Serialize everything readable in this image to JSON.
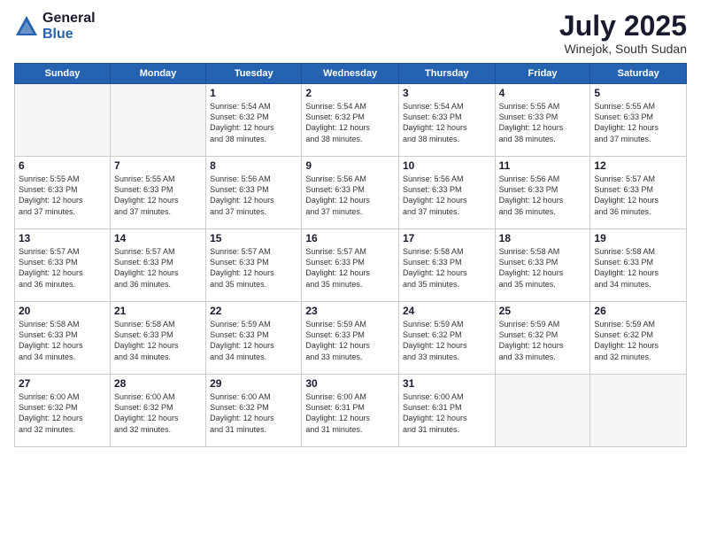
{
  "logo": {
    "general": "General",
    "blue": "Blue"
  },
  "header": {
    "month": "July 2025",
    "location": "Winejok, South Sudan"
  },
  "weekdays": [
    "Sunday",
    "Monday",
    "Tuesday",
    "Wednesday",
    "Thursday",
    "Friday",
    "Saturday"
  ],
  "weeks": [
    [
      {
        "day": "",
        "info": ""
      },
      {
        "day": "",
        "info": ""
      },
      {
        "day": "1",
        "info": "Sunrise: 5:54 AM\nSunset: 6:32 PM\nDaylight: 12 hours\nand 38 minutes."
      },
      {
        "day": "2",
        "info": "Sunrise: 5:54 AM\nSunset: 6:32 PM\nDaylight: 12 hours\nand 38 minutes."
      },
      {
        "day": "3",
        "info": "Sunrise: 5:54 AM\nSunset: 6:33 PM\nDaylight: 12 hours\nand 38 minutes."
      },
      {
        "day": "4",
        "info": "Sunrise: 5:55 AM\nSunset: 6:33 PM\nDaylight: 12 hours\nand 38 minutes."
      },
      {
        "day": "5",
        "info": "Sunrise: 5:55 AM\nSunset: 6:33 PM\nDaylight: 12 hours\nand 37 minutes."
      }
    ],
    [
      {
        "day": "6",
        "info": "Sunrise: 5:55 AM\nSunset: 6:33 PM\nDaylight: 12 hours\nand 37 minutes."
      },
      {
        "day": "7",
        "info": "Sunrise: 5:55 AM\nSunset: 6:33 PM\nDaylight: 12 hours\nand 37 minutes."
      },
      {
        "day": "8",
        "info": "Sunrise: 5:56 AM\nSunset: 6:33 PM\nDaylight: 12 hours\nand 37 minutes."
      },
      {
        "day": "9",
        "info": "Sunrise: 5:56 AM\nSunset: 6:33 PM\nDaylight: 12 hours\nand 37 minutes."
      },
      {
        "day": "10",
        "info": "Sunrise: 5:56 AM\nSunset: 6:33 PM\nDaylight: 12 hours\nand 37 minutes."
      },
      {
        "day": "11",
        "info": "Sunrise: 5:56 AM\nSunset: 6:33 PM\nDaylight: 12 hours\nand 36 minutes."
      },
      {
        "day": "12",
        "info": "Sunrise: 5:57 AM\nSunset: 6:33 PM\nDaylight: 12 hours\nand 36 minutes."
      }
    ],
    [
      {
        "day": "13",
        "info": "Sunrise: 5:57 AM\nSunset: 6:33 PM\nDaylight: 12 hours\nand 36 minutes."
      },
      {
        "day": "14",
        "info": "Sunrise: 5:57 AM\nSunset: 6:33 PM\nDaylight: 12 hours\nand 36 minutes."
      },
      {
        "day": "15",
        "info": "Sunrise: 5:57 AM\nSunset: 6:33 PM\nDaylight: 12 hours\nand 35 minutes."
      },
      {
        "day": "16",
        "info": "Sunrise: 5:57 AM\nSunset: 6:33 PM\nDaylight: 12 hours\nand 35 minutes."
      },
      {
        "day": "17",
        "info": "Sunrise: 5:58 AM\nSunset: 6:33 PM\nDaylight: 12 hours\nand 35 minutes."
      },
      {
        "day": "18",
        "info": "Sunrise: 5:58 AM\nSunset: 6:33 PM\nDaylight: 12 hours\nand 35 minutes."
      },
      {
        "day": "19",
        "info": "Sunrise: 5:58 AM\nSunset: 6:33 PM\nDaylight: 12 hours\nand 34 minutes."
      }
    ],
    [
      {
        "day": "20",
        "info": "Sunrise: 5:58 AM\nSunset: 6:33 PM\nDaylight: 12 hours\nand 34 minutes."
      },
      {
        "day": "21",
        "info": "Sunrise: 5:58 AM\nSunset: 6:33 PM\nDaylight: 12 hours\nand 34 minutes."
      },
      {
        "day": "22",
        "info": "Sunrise: 5:59 AM\nSunset: 6:33 PM\nDaylight: 12 hours\nand 34 minutes."
      },
      {
        "day": "23",
        "info": "Sunrise: 5:59 AM\nSunset: 6:33 PM\nDaylight: 12 hours\nand 33 minutes."
      },
      {
        "day": "24",
        "info": "Sunrise: 5:59 AM\nSunset: 6:32 PM\nDaylight: 12 hours\nand 33 minutes."
      },
      {
        "day": "25",
        "info": "Sunrise: 5:59 AM\nSunset: 6:32 PM\nDaylight: 12 hours\nand 33 minutes."
      },
      {
        "day": "26",
        "info": "Sunrise: 5:59 AM\nSunset: 6:32 PM\nDaylight: 12 hours\nand 32 minutes."
      }
    ],
    [
      {
        "day": "27",
        "info": "Sunrise: 6:00 AM\nSunset: 6:32 PM\nDaylight: 12 hours\nand 32 minutes."
      },
      {
        "day": "28",
        "info": "Sunrise: 6:00 AM\nSunset: 6:32 PM\nDaylight: 12 hours\nand 32 minutes."
      },
      {
        "day": "29",
        "info": "Sunrise: 6:00 AM\nSunset: 6:32 PM\nDaylight: 12 hours\nand 31 minutes."
      },
      {
        "day": "30",
        "info": "Sunrise: 6:00 AM\nSunset: 6:31 PM\nDaylight: 12 hours\nand 31 minutes."
      },
      {
        "day": "31",
        "info": "Sunrise: 6:00 AM\nSunset: 6:31 PM\nDaylight: 12 hours\nand 31 minutes."
      },
      {
        "day": "",
        "info": ""
      },
      {
        "day": "",
        "info": ""
      }
    ]
  ]
}
